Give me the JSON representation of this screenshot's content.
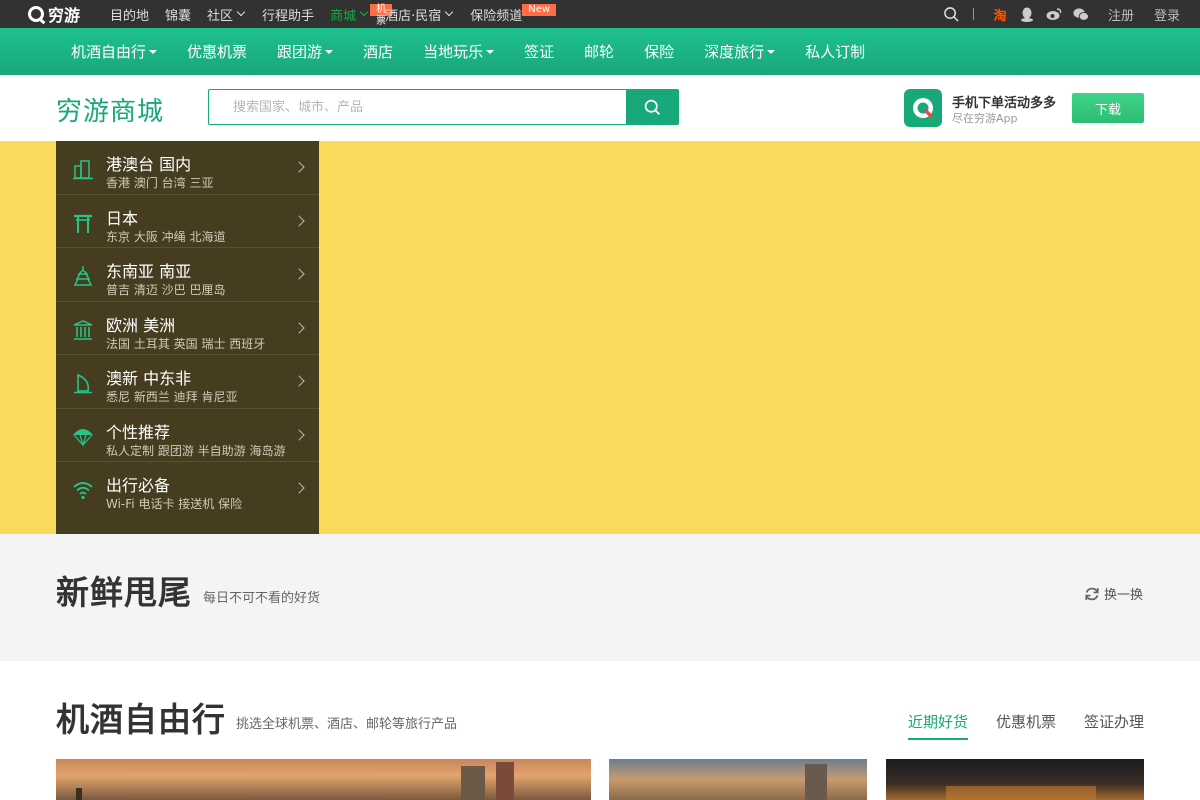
{
  "topbar": {
    "logo_text": "穷游",
    "nav": [
      {
        "label": "目的地",
        "caret": false,
        "active": false
      },
      {
        "label": "锦囊",
        "caret": false,
        "active": false
      },
      {
        "label": "社区",
        "caret": true,
        "active": false
      },
      {
        "label": "行程助手",
        "caret": false,
        "active": false
      },
      {
        "label": "商城",
        "caret": true,
        "active": true,
        "badge": "机票"
      },
      {
        "label": "酒店·民宿",
        "caret": true,
        "active": false
      },
      {
        "label": "保险频道",
        "caret": false,
        "active": false,
        "badge": "New"
      }
    ],
    "taobao_label": "淘",
    "register": "注册",
    "login": "登录",
    "colors": {
      "bg": "#323232",
      "active": "#10b041",
      "badge": "#ff6d47"
    }
  },
  "mainnav": {
    "items": [
      {
        "label": "机酒自由行",
        "dropdown": true
      },
      {
        "label": "优惠机票",
        "dropdown": false
      },
      {
        "label": "跟团游",
        "dropdown": true
      },
      {
        "label": "酒店",
        "dropdown": false
      },
      {
        "label": "当地玩乐",
        "dropdown": true
      },
      {
        "label": "签证",
        "dropdown": false
      },
      {
        "label": "邮轮",
        "dropdown": false
      },
      {
        "label": "保险",
        "dropdown": false
      },
      {
        "label": "深度旅行",
        "dropdown": true
      },
      {
        "label": "私人订制",
        "dropdown": false
      }
    ],
    "color": "#19a87a"
  },
  "header": {
    "brand": "穷游商城",
    "search_placeholder": "搜索国家、城市、产品",
    "app_title": "手机下单活动多多",
    "app_sub": "尽在穷游App",
    "download": "下载"
  },
  "banner": {
    "bg_color": "#f9da5b",
    "categories": [
      {
        "name": "港澳台 国内",
        "sub": "香港 澳门 台湾 三亚",
        "icon": "building-icon"
      },
      {
        "name": "日本",
        "sub": "东京 大阪 冲绳 北海道",
        "icon": "torii-gate-icon"
      },
      {
        "name": "东南亚 南亚",
        "sub": "普吉 清迈 沙巴 巴厘岛",
        "icon": "pagoda-icon"
      },
      {
        "name": "欧洲 美洲",
        "sub": "法国 土耳其 英国 瑞士 西班牙",
        "icon": "temple-icon"
      },
      {
        "name": "澳新 中东非",
        "sub": "悉尼 新西兰 迪拜 肯尼亚",
        "icon": "sail-building-icon"
      },
      {
        "name": "个性推荐",
        "sub": "私人定制 跟团游 半自助游 海岛游",
        "icon": "parachute-icon"
      },
      {
        "name": "出行必备",
        "sub": "Wi-Fi 电话卡 接送机 保险",
        "icon": "wifi-icon"
      }
    ]
  },
  "fresh": {
    "title": "新鲜甩尾",
    "subtitle": "每日不可不看的好货",
    "refresh": "换一换"
  },
  "flight_hotel": {
    "title": "机酒自由行",
    "subtitle": "挑选全球机票、酒店、邮轮等旅行产品",
    "tabs": [
      {
        "label": "近期好货",
        "active": true
      },
      {
        "label": "优惠机票",
        "active": false
      },
      {
        "label": "签证办理",
        "active": false
      }
    ]
  }
}
